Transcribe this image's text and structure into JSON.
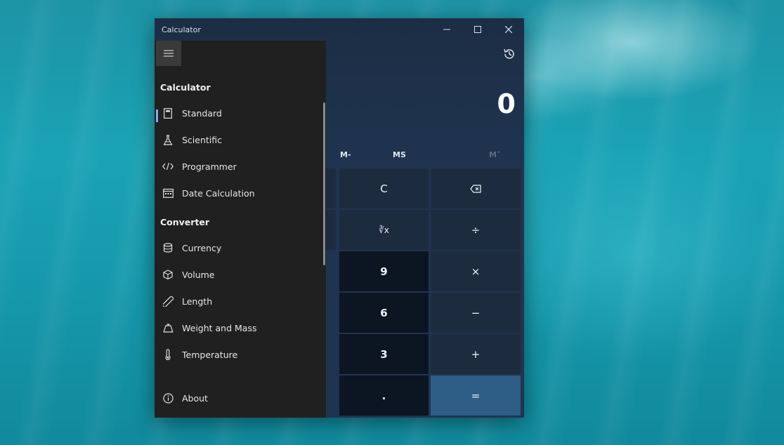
{
  "window": {
    "title": "Calculator",
    "minimize_glyph": "—",
    "maximize_glyph": "☐",
    "close_glyph": "✕"
  },
  "display": {
    "value": "0"
  },
  "memory": {
    "m_minus": "M-",
    "ms": "MS",
    "m_history": "M˅"
  },
  "keypad": {
    "clear": "C",
    "backspace_icon": "backspace-icon",
    "root": "∛x",
    "divide": "÷",
    "nine": "9",
    "multiply": "×",
    "six": "6",
    "minus": "−",
    "three": "3",
    "plus": "+",
    "decimal": ".",
    "equals": "="
  },
  "nav": {
    "calculator_header": "Calculator",
    "converter_header": "Converter",
    "items": [
      {
        "label": "Standard",
        "icon": "calculator-icon",
        "selected": true
      },
      {
        "label": "Scientific",
        "icon": "flask-icon"
      },
      {
        "label": "Programmer",
        "icon": "code-icon"
      },
      {
        "label": "Date Calculation",
        "icon": "calendar-icon"
      }
    ],
    "converters": [
      {
        "label": "Currency",
        "icon": "coins-icon"
      },
      {
        "label": "Volume",
        "icon": "cube-icon"
      },
      {
        "label": "Length",
        "icon": "ruler-icon"
      },
      {
        "label": "Weight and Mass",
        "icon": "weight-icon"
      },
      {
        "label": "Temperature",
        "icon": "thermometer-icon"
      }
    ],
    "about": {
      "label": "About",
      "icon": "info-icon"
    }
  },
  "colors": {
    "accent": "#7fb0e6",
    "equals_button": "#2e5d86",
    "nav_background": "#202020",
    "number_key": "#0c1522",
    "function_key": "#1d2b3e"
  }
}
